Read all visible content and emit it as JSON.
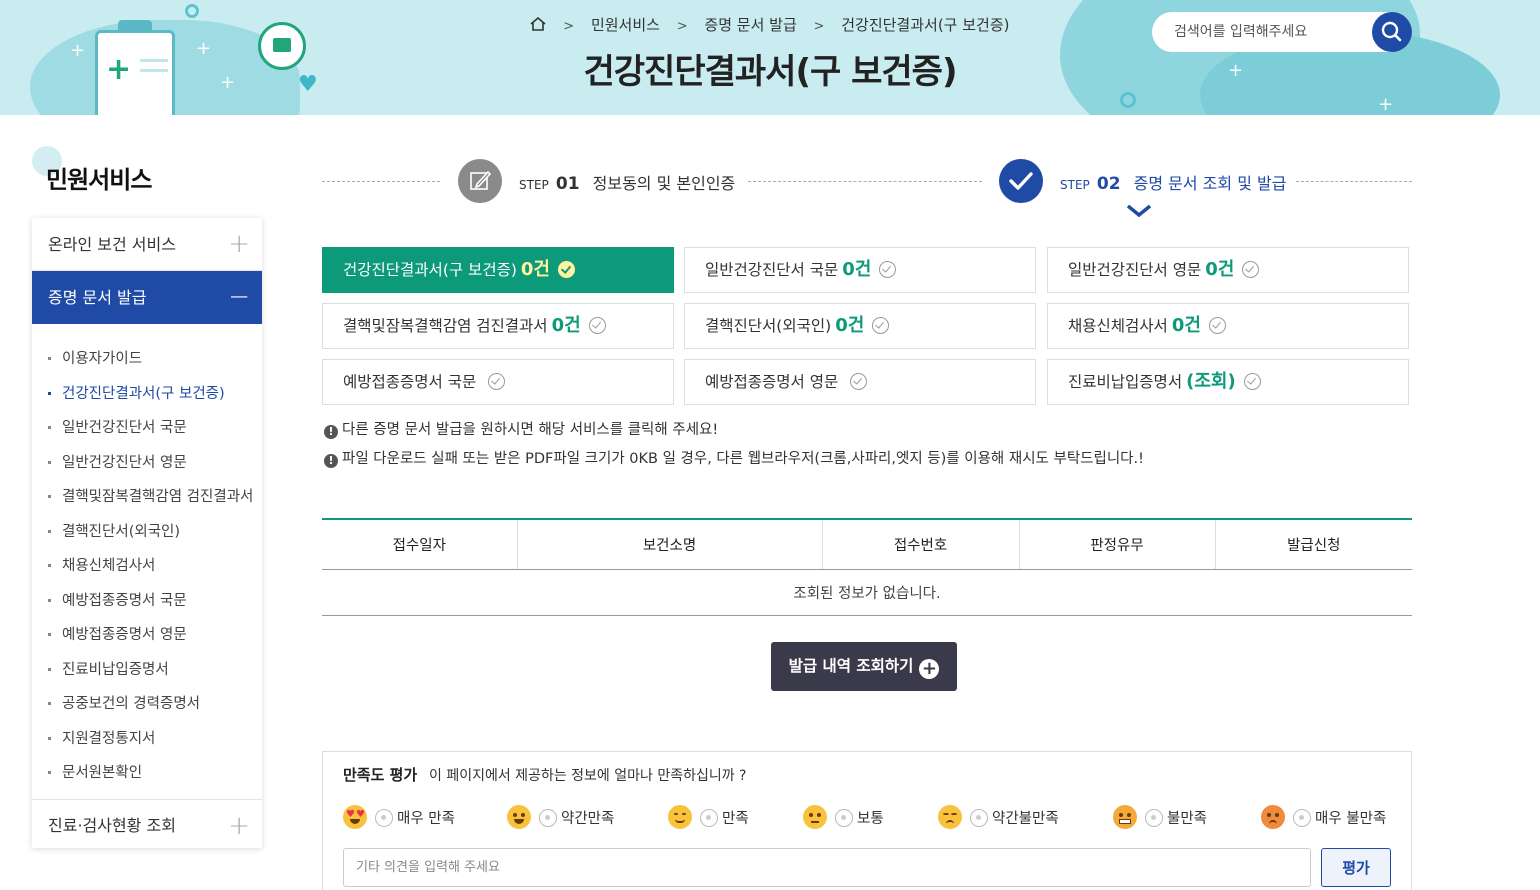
{
  "search": {
    "placeholder": "검색어를 입력해주세요"
  },
  "breadcrumb": {
    "items": [
      "민원서비스",
      "증명 문서 발급",
      "건강진단결과서(구 보건증)"
    ]
  },
  "page_title": "건강진단결과서(구 보건증)",
  "sidebar": {
    "title": "민원서비스",
    "menu": [
      {
        "label": "온라인 보건 서비스"
      },
      {
        "label": "증명 문서 발급"
      },
      {
        "label": "진료·검사현황 조회"
      }
    ],
    "sub_items": [
      {
        "label": "이용자가이드"
      },
      {
        "label": "건강진단결과서(구 보건증)"
      },
      {
        "label": "일반건강진단서 국문"
      },
      {
        "label": "일반건강진단서 영문"
      },
      {
        "label": "결핵및잠복결핵감염 검진결과서"
      },
      {
        "label": "결핵진단서(외국인)"
      },
      {
        "label": "채용신체검사서"
      },
      {
        "label": "예방접종증명서 국문"
      },
      {
        "label": "예방접종증명서 영문"
      },
      {
        "label": "진료비납입증명서"
      },
      {
        "label": "공중보건의 경력증명서"
      },
      {
        "label": "지원결정통지서"
      },
      {
        "label": "문서원본확인"
      }
    ]
  },
  "steps": [
    {
      "step_text": "STEP",
      "num": "01",
      "label": "정보동의 및 본인인증"
    },
    {
      "step_text": "STEP",
      "num": "02",
      "label": "증명 문서 조회 및 발급"
    }
  ],
  "documents": [
    {
      "label": "건강진단결과서(구 보건증)",
      "count": "0건"
    },
    {
      "label": "일반건강진단서 국문",
      "count": "0건"
    },
    {
      "label": "일반건강진단서 영문",
      "count": "0건"
    },
    {
      "label": "결핵및잠복결핵감염 검진결과서",
      "count": "0건"
    },
    {
      "label": "결핵진단서(외국인)",
      "count": "0건"
    },
    {
      "label": "채용신체검사서",
      "count": "0건"
    },
    {
      "label": "예방접종증명서 국문",
      "count": ""
    },
    {
      "label": "예방접종증명서 영문",
      "count": ""
    },
    {
      "label": "진료비납입증명서",
      "count": "(조회)"
    }
  ],
  "notices": [
    "다른 증명 문서 발급을 원하시면 해당 서비스를 클릭해 주세요!",
    "파일 다운로드 실패 또는 받은 PDF파일 크기가 0KB 일 경우, 다른 웹브라우저(크롬,사파리,엣지 등)를 이용해 재시도 부탁드립니다.!"
  ],
  "table": {
    "headers": [
      "접수일자",
      "보건소명",
      "접수번호",
      "판정유무",
      "발급신청"
    ],
    "empty_message": "조회된 정보가 없습니다."
  },
  "issue_button": "발급 내역 조회하기",
  "survey": {
    "title": "만족도 평가",
    "question": "이 페이지에서 제공하는 정보에 얼마나 만족하십니까 ?",
    "options": [
      {
        "label": "매우 만족",
        "emoji": "heart-eyes-icon"
      },
      {
        "label": "약간만족",
        "emoji": "grin-icon"
      },
      {
        "label": "만족",
        "emoji": "smile-icon"
      },
      {
        "label": "보통",
        "emoji": "neutral-icon"
      },
      {
        "label": "약간불만족",
        "emoji": "unamused-icon"
      },
      {
        "label": "불만족",
        "emoji": "grimace-icon"
      },
      {
        "label": "매우 불만족",
        "emoji": "angry-icon"
      }
    ],
    "comment_placeholder": "기타 의견을 입력해 주세요",
    "submit_label": "평가"
  },
  "colors": {
    "primary": "#1f4aa6",
    "accent": "#0d9a7a",
    "banner": "#c9ecf0"
  }
}
